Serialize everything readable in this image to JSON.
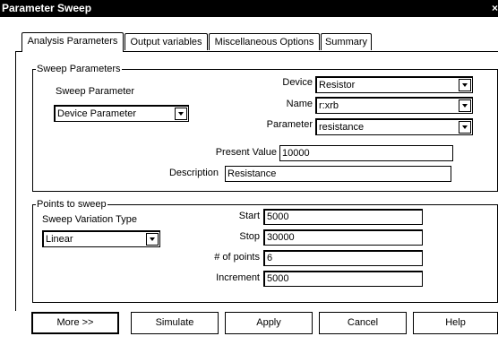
{
  "window": {
    "title": "Parameter Sweep",
    "close_glyph": "×"
  },
  "tabs": [
    {
      "label": "Analysis Parameters",
      "active": true
    },
    {
      "label": "Output variables",
      "active": false
    },
    {
      "label": "Miscellaneous Options",
      "active": false
    },
    {
      "label": "Summary",
      "active": false
    }
  ],
  "sweep_parameters": {
    "group_title": "Sweep Parameters",
    "sweep_parameter_label": "Sweep Parameter",
    "sweep_parameter_value": "Device Parameter",
    "device_label": "Device",
    "device_value": "Resistor",
    "name_label": "Name",
    "name_value": "r:xrb",
    "parameter_label": "Parameter",
    "parameter_value": "resistance",
    "present_value_label": "Present Value",
    "present_value": "10000",
    "description_label": "Description",
    "description_value": "Resistance"
  },
  "points_to_sweep": {
    "group_title": "Points to sweep",
    "variation_type_label": "Sweep Variation Type",
    "variation_type_value": "Linear",
    "start_label": "Start",
    "start_value": "5000",
    "stop_label": "Stop",
    "stop_value": "30000",
    "num_points_label": "# of points",
    "num_points_value": "6",
    "increment_label": "Increment",
    "increment_value": "5000"
  },
  "buttons": {
    "more": "More >>",
    "simulate": "Simulate",
    "apply": "Apply",
    "cancel": "Cancel",
    "help": "Help"
  },
  "icons": {
    "dropdown_arrow": "chevron-down-icon",
    "close": "close-icon"
  }
}
